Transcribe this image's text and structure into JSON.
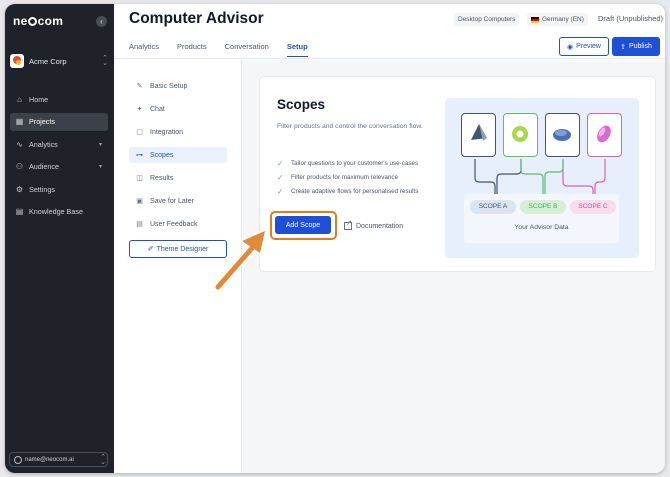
{
  "sidebar": {
    "logo": {
      "prefix": "ne",
      "suffix": "com"
    },
    "collapse_icon": "‹",
    "org": {
      "name": "Acme Corp"
    },
    "items": [
      {
        "label": "Home",
        "icon": "⌂",
        "active": false
      },
      {
        "label": "Projects",
        "icon": "▦",
        "active": true
      },
      {
        "label": "Analytics",
        "icon": "∿",
        "active": false,
        "caret": "▾"
      },
      {
        "label": "Audience",
        "icon": "⚇",
        "active": false,
        "caret": "▾"
      },
      {
        "label": "Settings",
        "icon": "⚙",
        "active": false
      },
      {
        "label": "Knowledge Base",
        "icon": "▤",
        "active": false
      }
    ],
    "user": {
      "email": "name@neocom.ai"
    }
  },
  "header": {
    "title": "Computer Advisor",
    "category_tag": "Desktop Computers",
    "language_tag": "Germany (EN)",
    "status": "Draft (Unpublished)",
    "tabs": [
      {
        "label": "Analytics",
        "active": false
      },
      {
        "label": "Products",
        "active": false
      },
      {
        "label": "Conversation",
        "active": false
      },
      {
        "label": "Setup",
        "active": true
      }
    ],
    "preview_label": "Preview",
    "publish_label": "Publish"
  },
  "subnav": {
    "items": [
      {
        "label": "Basic Setup",
        "icon": "✎",
        "active": false
      },
      {
        "label": "Chat",
        "icon": "✦",
        "active": false
      },
      {
        "label": "Integration",
        "icon": "▢",
        "active": false
      },
      {
        "label": "Scopes",
        "icon": "⊶",
        "active": true
      },
      {
        "label": "Results",
        "icon": "◫",
        "active": false
      },
      {
        "label": "Save for Later",
        "icon": "▣",
        "active": false
      },
      {
        "label": "User Feedback",
        "icon": "▤",
        "active": false
      }
    ],
    "theme_designer_label": "Theme Designer"
  },
  "scopes": {
    "title": "Scopes",
    "description": "Filter products and control the conversation flow.",
    "checks": [
      "Tailor questions to your customer's use-cases",
      "Filter products for maximum relevance",
      "Create adaptive flows for personalised results"
    ],
    "add_label": "Add Scope",
    "doc_label": "Documentation"
  },
  "illustration": {
    "scope_labels": [
      "SCOPE A",
      "SCOPE B",
      "SCOPE C"
    ],
    "output_label": "Your Advisor Data",
    "colors": {
      "scope_a": "#3f566f",
      "scope_b": "#5cbf6e",
      "scope_c": "#d763a8"
    }
  },
  "colors": {
    "primary": "#1f4fd6",
    "highlight": "#e07b28",
    "sidebar_bg": "#1f2329"
  }
}
